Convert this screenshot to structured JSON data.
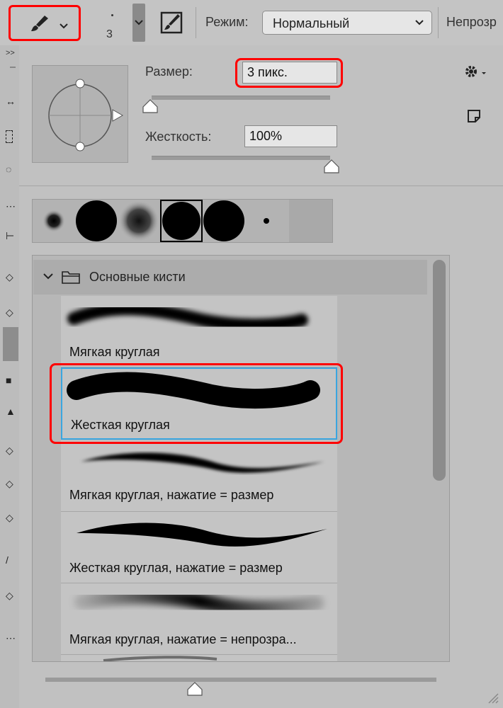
{
  "toolbar": {
    "brush_size": "3",
    "mode_label": "Режим:",
    "mode_value": "Нормальный",
    "opacity_label": "Непрозр"
  },
  "left_strip": {
    "collapse_label": ">>"
  },
  "panel": {
    "size_label": "Размер:",
    "size_value": "3 пикс.",
    "hardness_label": "Жесткость:",
    "hardness_value": "100%",
    "size_slider_fraction": 0.0,
    "hardness_slider_fraction": 1.0
  },
  "thumbnails": [
    {
      "icon": "soft-small-brush-icon"
    },
    {
      "icon": "hard-large-brush-icon"
    },
    {
      "icon": "soft-large-brush-icon"
    },
    {
      "icon": "hard-large-brush-icon",
      "selected": true
    },
    {
      "icon": "hard-large-brush-icon"
    },
    {
      "icon": "hard-small-brush-icon"
    },
    {
      "icon": "empty-slot"
    }
  ],
  "brush_list": {
    "group_title": "Основные кисти",
    "items": [
      {
        "name": "Мягкая круглая",
        "stroke": "soft"
      },
      {
        "name": "Жесткая круглая",
        "stroke": "hard",
        "selected": true
      },
      {
        "name": "Мягкая круглая, нажатие = размер",
        "stroke": "soft-taper"
      },
      {
        "name": "Жесткая круглая, нажатие = размер",
        "stroke": "hard-taper"
      },
      {
        "name": "Мягкая круглая, нажатие = непрозра...",
        "stroke": "soft-fade"
      }
    ]
  },
  "colors": {
    "highlight": "#ff0000",
    "selection": "#3aa6e0"
  }
}
